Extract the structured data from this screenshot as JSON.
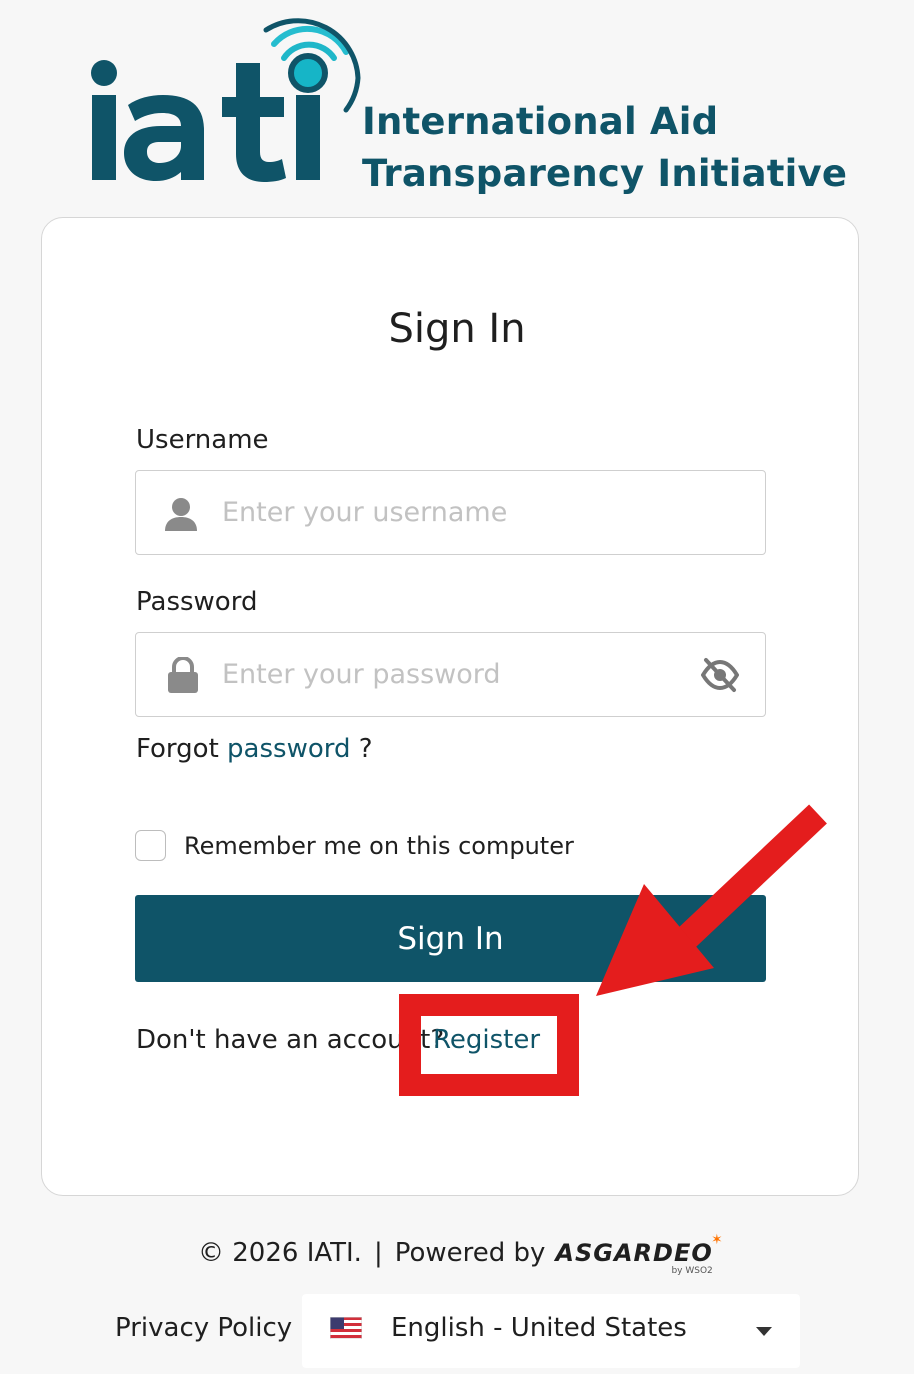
{
  "logo": {
    "wordmark": "iati",
    "name_line1": "International Aid",
    "name_line2": "Transparency Initiative"
  },
  "form": {
    "title": "Sign In",
    "username_label": "Username",
    "username_placeholder": "Enter your username",
    "password_label": "Password",
    "password_placeholder": "Enter your password",
    "forgot_prefix": "Forgot",
    "forgot_link": "password",
    "forgot_suffix": "?",
    "remember_label": "Remember me on this computer",
    "submit_label": "Sign In",
    "no_account_text": "Don't have an account?",
    "register_link": "Register"
  },
  "footer": {
    "copyright": "© 2026 IATI.",
    "separator": "|",
    "powered_by": "Powered by",
    "brand": "ASGARDEO",
    "brand_sub": "by WSO2",
    "privacy": "Privacy Policy",
    "language": "English - United States"
  },
  "icons": {
    "username": "user-icon",
    "password": "lock-icon",
    "toggle_password": "eye-slash-icon",
    "language_flag": "us-flag-icon",
    "language_caret": "caret-down-icon"
  },
  "colors": {
    "brand": "#0f5468",
    "annotation": "#e41d1d",
    "placeholder": "#c2c2c2"
  }
}
